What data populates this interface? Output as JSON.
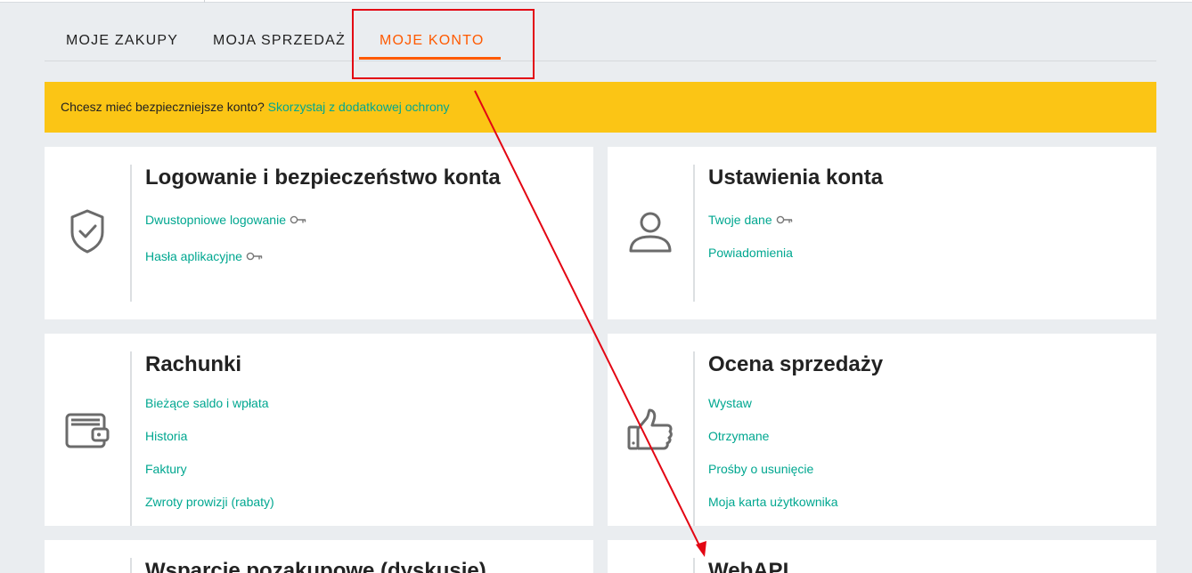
{
  "tabs": [
    {
      "label": "MOJE ZAKUPY"
    },
    {
      "label": "MOJA SPRZEDAŻ"
    },
    {
      "label": "MOJE KONTO"
    }
  ],
  "colors": {
    "accent": "#ff5a00",
    "link": "#00a790",
    "banner": "#fbc515",
    "annotation": "#e30613"
  },
  "banner": {
    "text": "Chcesz mieć bezpieczniejsze konto?",
    "link": "Skorzystaj z dodatkowej ochrony"
  },
  "cards": {
    "security": {
      "icon": "shield-check-icon",
      "title": "Logowanie i bezpieczeństwo konta",
      "links": [
        "Dwustopniowe logowanie",
        "Hasła aplikacyjne"
      ]
    },
    "settings": {
      "icon": "user-icon",
      "title": "Ustawienia konta",
      "links": [
        "Twoje dane",
        "Powiadomienia"
      ]
    },
    "bills": {
      "icon": "wallet-icon",
      "title": "Rachunki",
      "links": [
        "Bieżące saldo i wpłata",
        "Historia",
        "Faktury",
        "Zwroty prowizji (rabaty)"
      ]
    },
    "rating": {
      "icon": "thumbs-up-icon",
      "title": "Ocena sprzedaży",
      "links": [
        "Wystaw",
        "Otrzymane",
        "Prośby o usunięcie",
        "Moja karta użytkownika"
      ]
    },
    "support": {
      "title": "Wsparcie pozakupowe (dyskusje)"
    },
    "webapi": {
      "title": "WebAPI"
    }
  }
}
